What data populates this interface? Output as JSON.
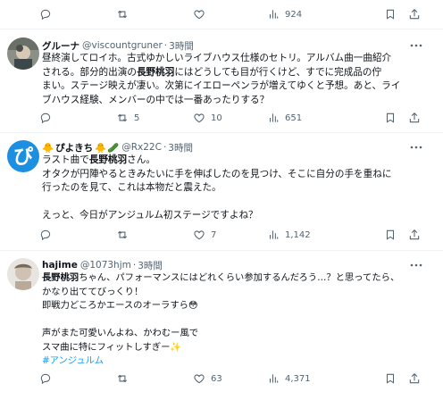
{
  "top_actions": {
    "views": "924"
  },
  "tweets": [
    {
      "display_name": "グルーナ",
      "handle": "@viscountgruner",
      "time": "3時間",
      "lines": [
        "昼終演してロイホ。古式ゆかしいライブハウス仕様のセトリ。アルバム曲一曲紹介",
        [
          "される。部分的出演の",
          "長野桃羽",
          "にはどうしても目が行くけど、すでに完成品の佇"
        ],
        "まい。ステージ映えが凄い。次第にイエローペンラが増えてゆくと予想。あと、ライ",
        "ブハウス経験、メンバーの中では一番あったりする？"
      ],
      "replies": "",
      "reposts": "5",
      "likes": "10",
      "views": "651"
    },
    {
      "display_name": "ぴよきち",
      "handle": "@Rx22C",
      "time": "3時間",
      "lines": [
        [
          "ラスト曲で",
          "長野桃羽",
          "さん。"
        ],
        "オタクが円陣やるときみたいに手を伸ばしたのを見つけ、そこに自分の手を重ねに",
        "行ったのを見て、これは本物だと震えた。",
        "",
        "えっと、今日がアンジュルム初ステージですよね？"
      ],
      "replies": "",
      "reposts": "",
      "likes": "7",
      "views": "1,142"
    },
    {
      "display_name": "hajime",
      "handle": "@1073hjm",
      "time": "3時間",
      "lines": [
        [
          "",
          "長野桃羽",
          "ちゃん、パフォーマンスにはどれくらい参加するんだろう…？と思ってたら、"
        ],
        "かなり出ててびっくり！",
        "即戦力どころかエースのオーラすら😳",
        "",
        "声がまた可愛いんよね、かわむー風で",
        "スマ曲に特にフィットしすぎー✨",
        "#アンジュルム"
      ],
      "replies": "",
      "reposts": "",
      "likes": "63",
      "views": "4,371"
    }
  ],
  "icons": {
    "reply": "reply-icon",
    "repost": "repost-icon",
    "like": "heart-icon",
    "views": "views-icon",
    "bookmark": "bookmark-icon",
    "share": "share-icon",
    "more": "more-icon"
  },
  "colors": {
    "text": "#0f1419",
    "muted": "#536471",
    "link": "#1d9bf0",
    "divider": "#eff3f4"
  }
}
